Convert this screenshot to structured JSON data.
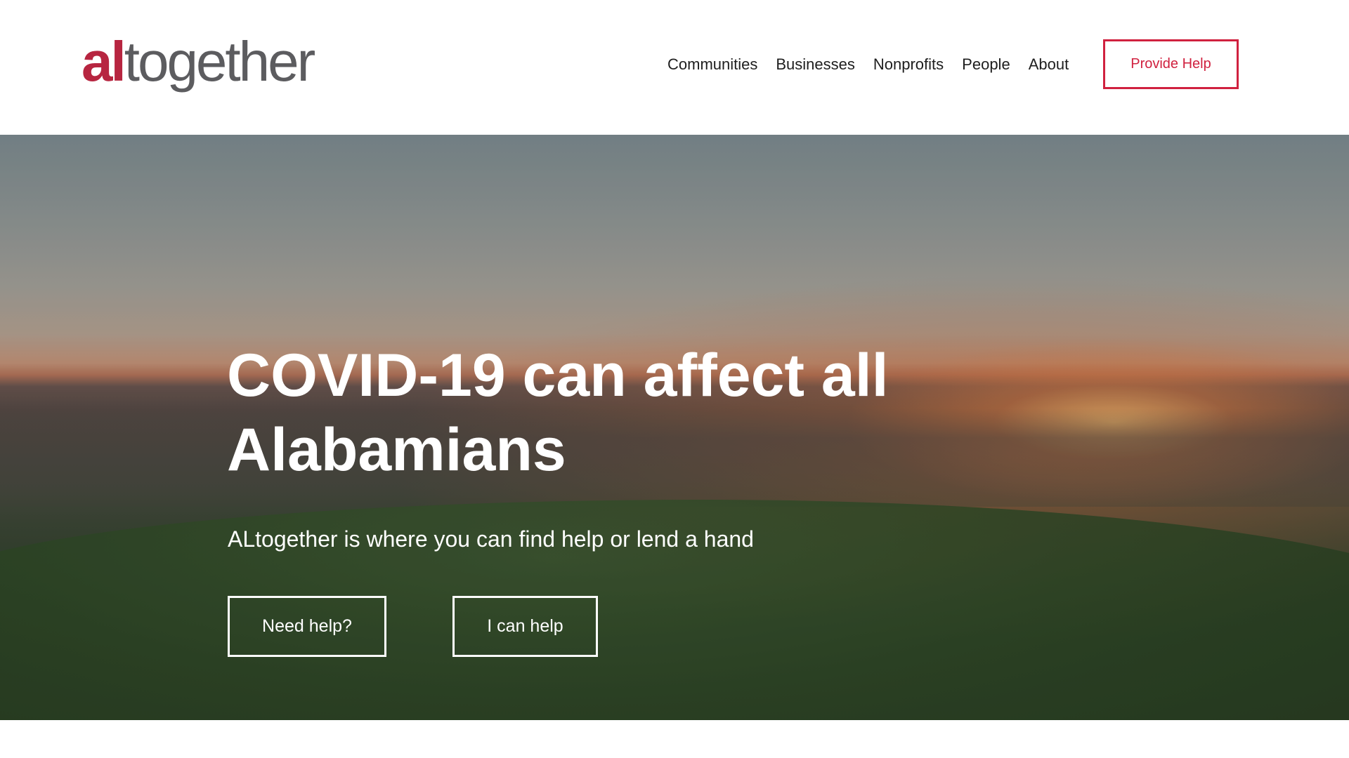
{
  "logo": {
    "accent": "al",
    "rest": "together"
  },
  "nav": {
    "items": [
      {
        "label": "Communities"
      },
      {
        "label": "Businesses"
      },
      {
        "label": "Nonprofits"
      },
      {
        "label": "People"
      },
      {
        "label": "About"
      }
    ],
    "cta_label": "Provide Help"
  },
  "hero": {
    "title": "COVID-19 can affect all Alabamians",
    "subtitle": "ALtogether is where you can find help or lend a hand",
    "buttons": {
      "need_help": "Need help?",
      "can_help": "I can help"
    }
  },
  "colors": {
    "brand_red": "#b72540",
    "cta_red": "#d0213f",
    "logo_gray": "#5c5c5f",
    "hero_text": "#ffffff"
  }
}
